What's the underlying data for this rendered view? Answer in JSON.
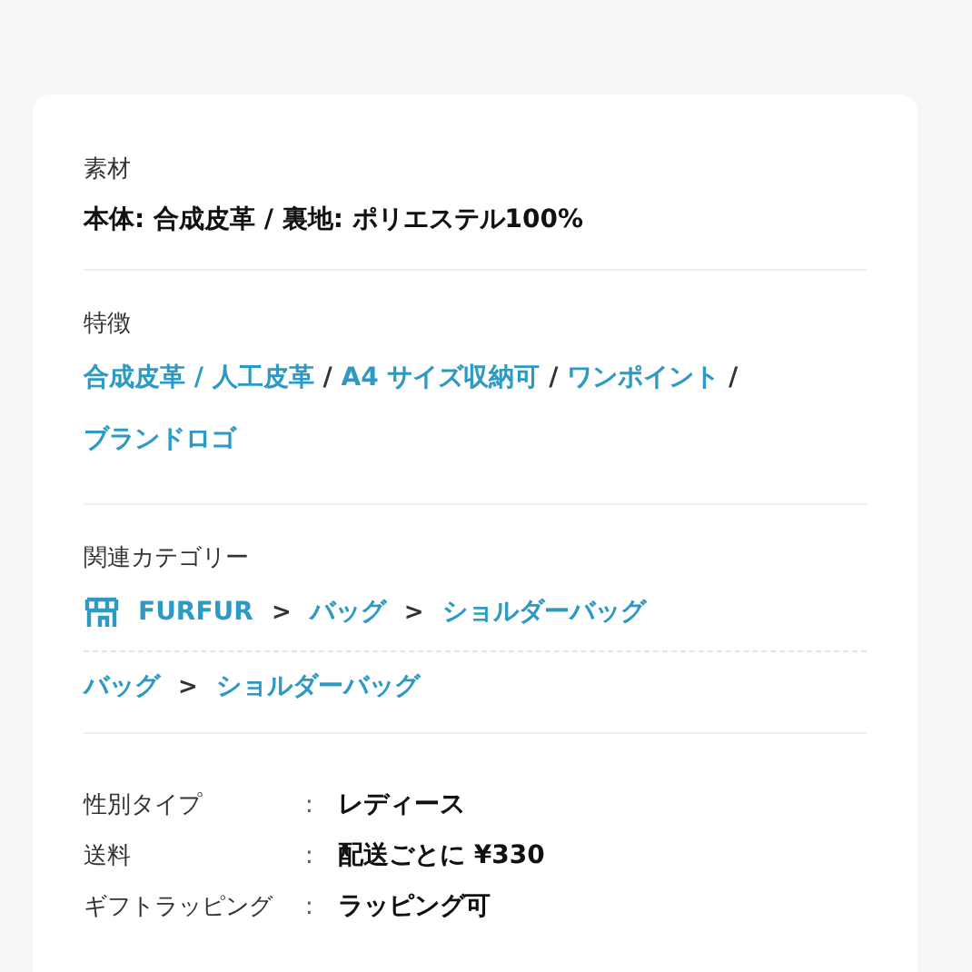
{
  "material": {
    "label": "素材",
    "value": "本体: 合成皮革 / 裏地: ポリエステル100%"
  },
  "features": {
    "label": "特徴",
    "parts": [
      {
        "kind": "link",
        "text": "合成皮革 / 人工皮革"
      },
      {
        "kind": "separator",
        "text": "/"
      },
      {
        "kind": "link",
        "text": "A4 サイズ収納可"
      },
      {
        "kind": "separator",
        "text": "/"
      },
      {
        "kind": "link",
        "text": "ワンポイント"
      },
      {
        "kind": "separator",
        "text": "/"
      },
      {
        "kind": "link",
        "text": "ブランドロゴ"
      }
    ]
  },
  "related_categories": {
    "label": "関連カテゴリー",
    "paths": [
      {
        "store": true,
        "parts": [
          {
            "kind": "link",
            "text": "FURFUR"
          },
          {
            "kind": "separator",
            "text": ">"
          },
          {
            "kind": "link",
            "text": "バッグ"
          },
          {
            "kind": "separator",
            "text": ">"
          },
          {
            "kind": "link",
            "text": "ショルダーバッグ"
          }
        ]
      },
      {
        "store": false,
        "parts": [
          {
            "kind": "link",
            "text": "バッグ"
          },
          {
            "kind": "separator",
            "text": ">"
          },
          {
            "kind": "link",
            "text": "ショルダーバッグ"
          }
        ]
      }
    ]
  },
  "specs": [
    {
      "label": "性別タイプ",
      "colon": ":",
      "value": "レディース"
    },
    {
      "label": "送料",
      "colon": ":",
      "value": "配送ごとに ¥330"
    },
    {
      "label": "ギフトラッピング",
      "colon": ":",
      "value": "ラッピング可"
    }
  ]
}
